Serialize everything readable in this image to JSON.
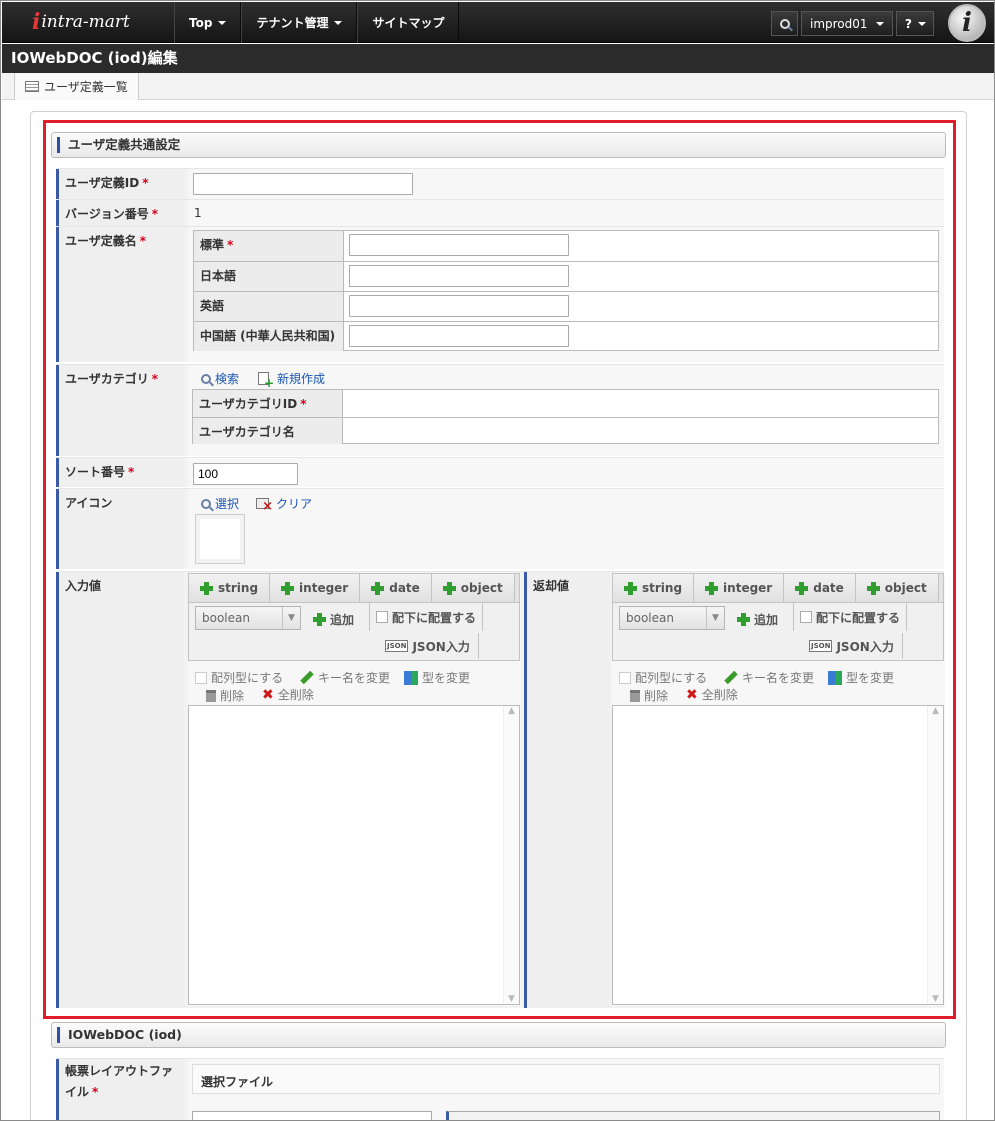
{
  "header": {
    "logo_text": "intra-mart",
    "nav": [
      "Top",
      "テナント管理",
      "サイトマップ"
    ],
    "user": "improd01",
    "help": "?",
    "avatar_letter": "i"
  },
  "page_title": "IOWebDOC (iod)編集",
  "subtab_label": "ユーザ定義一覧",
  "section1": {
    "heading": "ユーザ定義共通設定",
    "user_def_id": {
      "label": "ユーザ定義ID",
      "value": ""
    },
    "version": {
      "label": "バージョン番号",
      "value": "1"
    },
    "user_def_name": {
      "label": "ユーザ定義名",
      "locales": [
        {
          "name": "標準",
          "required": true,
          "value": ""
        },
        {
          "name": "日本語",
          "required": false,
          "value": ""
        },
        {
          "name": "英語",
          "required": false,
          "value": ""
        },
        {
          "name": "中国語 (中華人民共和国)",
          "required": false,
          "value": ""
        }
      ]
    },
    "category": {
      "label": "ユーザカテゴリ",
      "search": "検索",
      "create": "新規作成",
      "id_label": "ユーザカテゴリID",
      "name_label": "ユーザカテゴリ名"
    },
    "sort": {
      "label": "ソート番号",
      "value": "100"
    },
    "icon": {
      "label": "アイコン",
      "select": "選択",
      "clear": "クリア"
    },
    "input": {
      "label": "入力値",
      "tabs": [
        "string",
        "integer",
        "date",
        "object"
      ],
      "select_value": "boolean",
      "add": "追加",
      "place_under": "配下に配置する",
      "json_input": "JSON入力",
      "array_type": "配列型にする",
      "rename_key": "キー名を変更",
      "change_type": "型を変更",
      "delete": "削除",
      "delete_all": "全削除"
    },
    "output": {
      "label": "返却値",
      "tabs": [
        "string",
        "integer",
        "date",
        "object"
      ],
      "select_value": "boolean",
      "add": "追加",
      "place_under": "配下に配置する",
      "json_input": "JSON入力",
      "array_type": "配列型にする",
      "rename_key": "キー名を変更",
      "change_type": "型を変更",
      "delete": "削除",
      "delete_all": "全削除"
    }
  },
  "section2": {
    "heading": "IOWebDOC (iod)",
    "layout_label": "帳票レイアウトファイル",
    "select_file": "選択ファイル"
  },
  "colors": {
    "accent": "#3b5aa8",
    "highlight": "#e01e2b",
    "link": "#1a56b3"
  }
}
